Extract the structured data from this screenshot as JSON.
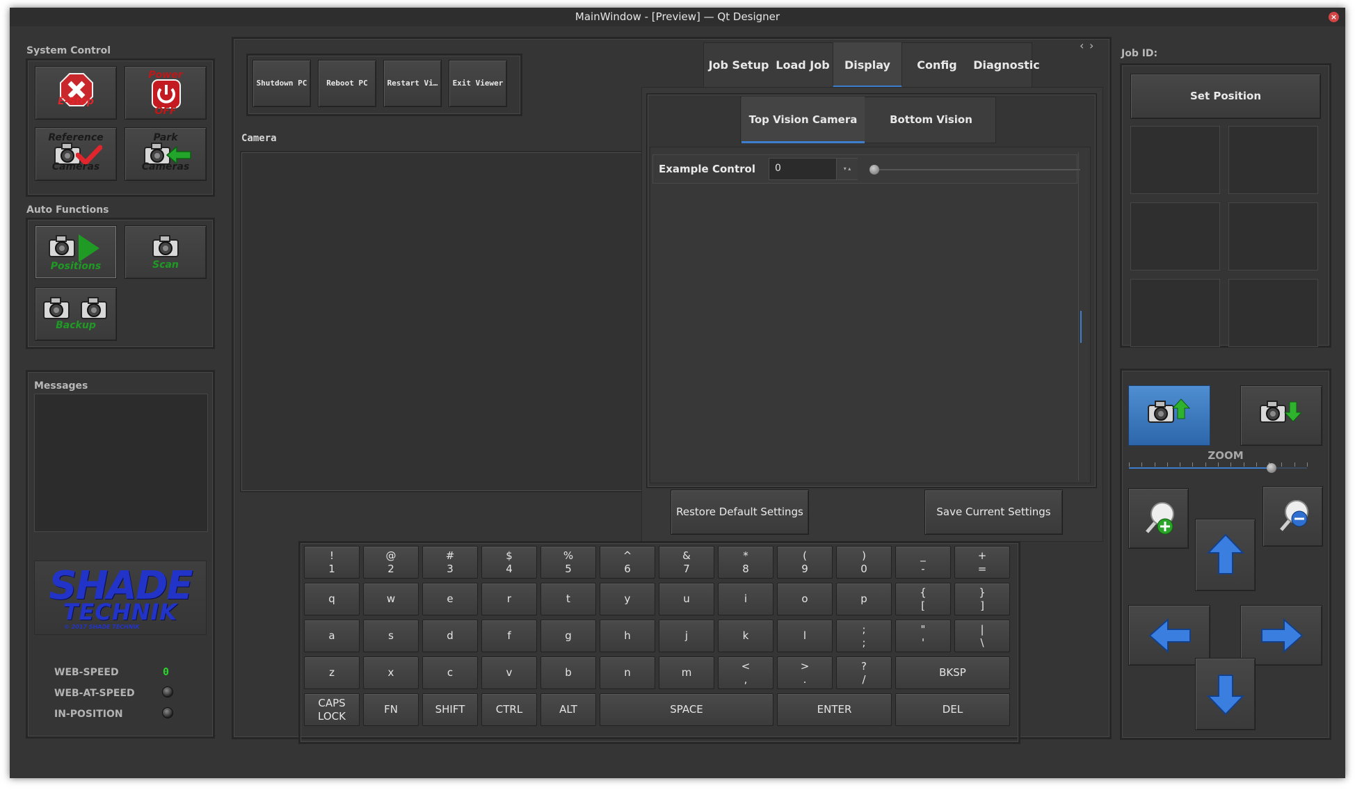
{
  "window": {
    "title": "MainWindow - [Preview] — Qt Designer",
    "close_glyph": "×"
  },
  "system_control": {
    "title": "System Control",
    "estop_label": "E-Stop",
    "power_top": "Power",
    "power_bottom": "OFF",
    "reference_top": "Reference",
    "reference_bottom": "Cameras",
    "park_top": "Park",
    "park_bottom": "Cameras"
  },
  "auto_functions": {
    "title": "Auto Functions",
    "positions_label": "Positions",
    "scan_label": "Scan",
    "backup_label": "Backup"
  },
  "messages": {
    "title": "Messages"
  },
  "logo": {
    "line1": "SHADE",
    "line2": "TECHNIK",
    "copyright": "© 2017 SHADE TECHNIK"
  },
  "status": {
    "web_speed_label": "WEB-SPEED",
    "web_speed_value": "0",
    "web_at_speed_label": "WEB-AT-SPEED",
    "in_position_label": "IN-POSITION"
  },
  "top_buttons": [
    "Shutdown PC",
    "Reboot PC",
    "Restart Vi…",
    "Exit Viewer"
  ],
  "camera": {
    "title": "Camera"
  },
  "main_tabs": {
    "items": [
      "Job Setup",
      "Load Job",
      "Display",
      "Config",
      "Diagnostic"
    ],
    "active": "Display",
    "scroll_left": "‹",
    "scroll_right": "›"
  },
  "display": {
    "subtabs": [
      "Top Vision Camera",
      "Bottom Vision Camera"
    ],
    "active_subtab": "Top Vision Camera",
    "example_control_label": "Example Control",
    "example_control_value": "0",
    "example_slider_level": 0.0,
    "restore_button": "Restore Default Settings",
    "save_button": "Save Current Settings"
  },
  "keyboard": {
    "rows": [
      [
        [
          "!",
          "1"
        ],
        [
          "@",
          "2"
        ],
        [
          "#",
          "3"
        ],
        [
          "$",
          "4"
        ],
        [
          "%",
          "5"
        ],
        [
          "^",
          "6"
        ],
        [
          "&",
          "7"
        ],
        [
          "*",
          "8"
        ],
        [
          "(",
          "9"
        ],
        [
          ")",
          "0"
        ],
        [
          "_",
          "-"
        ],
        [
          "+",
          "="
        ]
      ],
      [
        [
          "q"
        ],
        [
          "w"
        ],
        [
          "e"
        ],
        [
          "r"
        ],
        [
          "t"
        ],
        [
          "y"
        ],
        [
          "u"
        ],
        [
          "i"
        ],
        [
          "o"
        ],
        [
          "p"
        ],
        [
          "{",
          "["
        ],
        [
          "}",
          "]"
        ]
      ],
      [
        [
          "a"
        ],
        [
          "s"
        ],
        [
          "d"
        ],
        [
          "f"
        ],
        [
          "g"
        ],
        [
          "h"
        ],
        [
          "j"
        ],
        [
          "k"
        ],
        [
          "l"
        ],
        [
          ";",
          ";"
        ],
        [
          "\"",
          "'"
        ],
        [
          "|",
          "\\"
        ]
      ],
      [
        [
          "z"
        ],
        [
          "x"
        ],
        [
          "c"
        ],
        [
          "v"
        ],
        [
          "b"
        ],
        [
          "n"
        ],
        [
          "m"
        ],
        [
          "<",
          ","
        ],
        [
          ">",
          "."
        ],
        [
          "?",
          "/"
        ],
        [
          "BKSP"
        ]
      ],
      [
        [
          "CAPS",
          "LOCK"
        ],
        [
          "FN"
        ],
        [
          "SHIFT"
        ],
        [
          "CTRL"
        ],
        [
          "ALT"
        ],
        [
          "SPACE"
        ],
        [
          "ENTER"
        ],
        [
          "DEL"
        ]
      ]
    ]
  },
  "job": {
    "id_label": "Job ID:",
    "set_position_button": "Set Position"
  },
  "jog": {
    "zoom_label": "ZOOM",
    "zoom_level": 0.8
  }
}
